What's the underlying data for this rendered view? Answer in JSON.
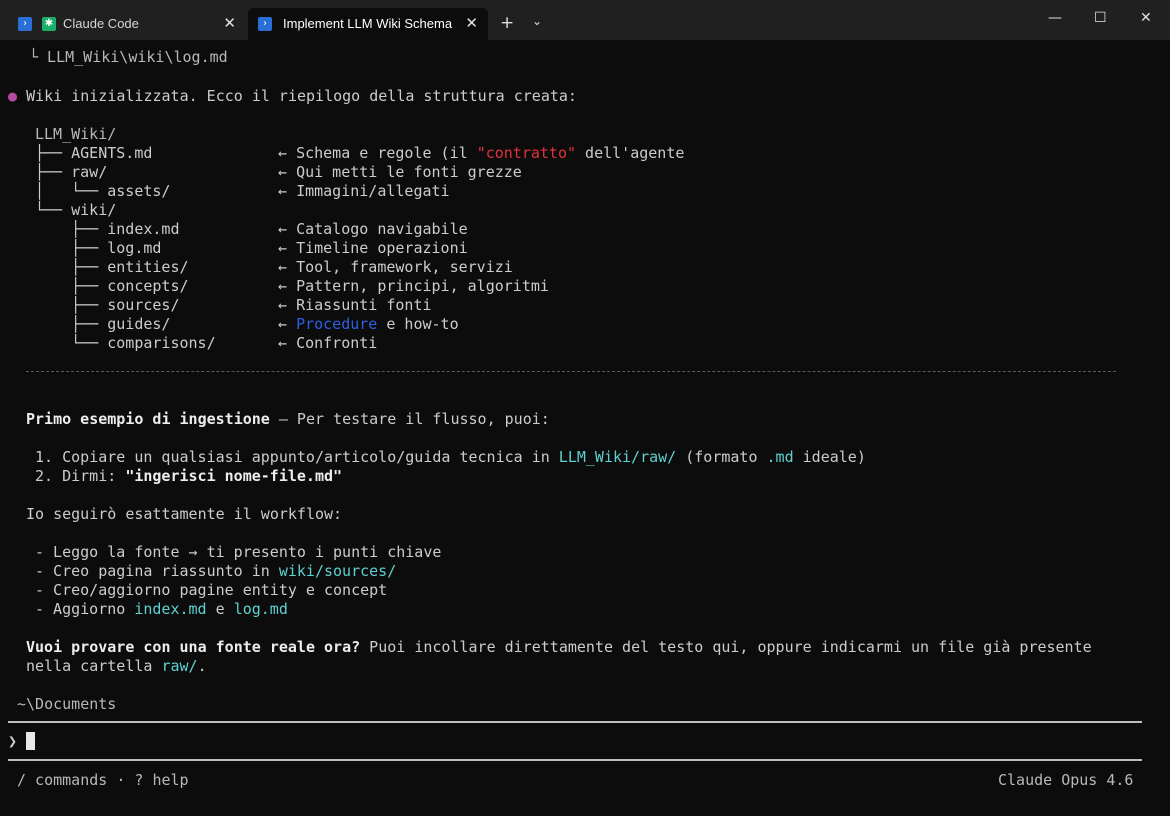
{
  "tabs": [
    {
      "label": "Claude Code",
      "icon": "powershell-icon",
      "extra_icon": "claude-icon"
    },
    {
      "label": "Implement LLM Wiki Schema",
      "icon": "powershell-icon"
    }
  ],
  "window": {
    "new_tab": "+",
    "dropdown": "⌄",
    "minimize": "—",
    "maximize": "☐",
    "close": "✕"
  },
  "terminal": {
    "top_path": "└ LLM_Wiki\\wiki\\log.md",
    "bullet": "●",
    "intro": "Wiki inizializzata. Ecco il riepilogo della struttura creata:",
    "tree": [
      {
        "prefix": "LLM_Wiki/",
        "arrow": "",
        "desc": ""
      },
      {
        "prefix": "├── AGENTS.md",
        "arrow": "←",
        "desc_before": "Schema e regole (il ",
        "desc_highlight": "\"contratto\"",
        "desc_after": " dell'agente"
      },
      {
        "prefix": "├── raw/",
        "arrow": "←",
        "desc": "Qui metti le fonti grezze"
      },
      {
        "prefix": "│   └── assets/",
        "arrow": "←",
        "desc": "Immagini/allegati"
      },
      {
        "prefix": "└── wiki/",
        "arrow": "",
        "desc": ""
      },
      {
        "prefix": "    ├── index.md",
        "arrow": "←",
        "desc": "Catalogo navigabile"
      },
      {
        "prefix": "    ├── log.md",
        "arrow": "←",
        "desc": "Timeline operazioni"
      },
      {
        "prefix": "    ├── entities/",
        "arrow": "←",
        "desc": "Tool, framework, servizi"
      },
      {
        "prefix": "    ├── concepts/",
        "arrow": "←",
        "desc": "Pattern, principi, algoritmi"
      },
      {
        "prefix": "    ├── sources/",
        "arrow": "←",
        "desc": "Riassunti fonti"
      },
      {
        "prefix": "    ├── guides/",
        "arrow": "←",
        "desc_highlight": "Procedure",
        "desc_after": " e how-to"
      },
      {
        "prefix": "    └── comparisons/",
        "arrow": "←",
        "desc": "Confronti"
      }
    ],
    "example_title": "Primo esempio di ingestione",
    "example_rest": " — Per testare il flusso, puoi:",
    "step1_pre": "1. Copiare un qualsiasi appunto/articolo/guida tecnica in ",
    "step1_path": "LLM_Wiki/raw/",
    "step1_mid": " (formato ",
    "step1_ext": ".md",
    "step1_post": " ideale)",
    "step2_pre": "2. Dirmi: ",
    "step2_cmd": "\"ingerisci nome-file.md\"",
    "workflow_intro": "Io seguirò esattamente il workflow:",
    "wf1": "- Leggo la fonte → ti presento i punti chiave",
    "wf2_pre": "- Creo pagina riassunto in ",
    "wf2_path": "wiki/sources/",
    "wf3": "- Creo/aggiorno pagine entity e concept",
    "wf4_pre": "- Aggiorno ",
    "wf4_a": "index.md",
    "wf4_mid": " e ",
    "wf4_b": "log.md",
    "question_bold": "Vuoi provare con una fonte reale ora?",
    "question_rest": " Puoi incollare direttamente del testo qui, oppure indicarmi un file già presente",
    "question_line2_pre": "nella cartella ",
    "question_line2_path": "raw/",
    "question_line2_post": ".",
    "cwd": "~\\Documents",
    "prompt_symbol": "❯",
    "footer_left": "/ commands · ? help",
    "footer_right": "Claude Opus 4.6"
  },
  "colors": {
    "accent_cyan": "#5fd1d1",
    "accent_red": "#e0323c",
    "accent_blue": "#2f5fe6",
    "bullet_purple": "#b24a9e"
  }
}
